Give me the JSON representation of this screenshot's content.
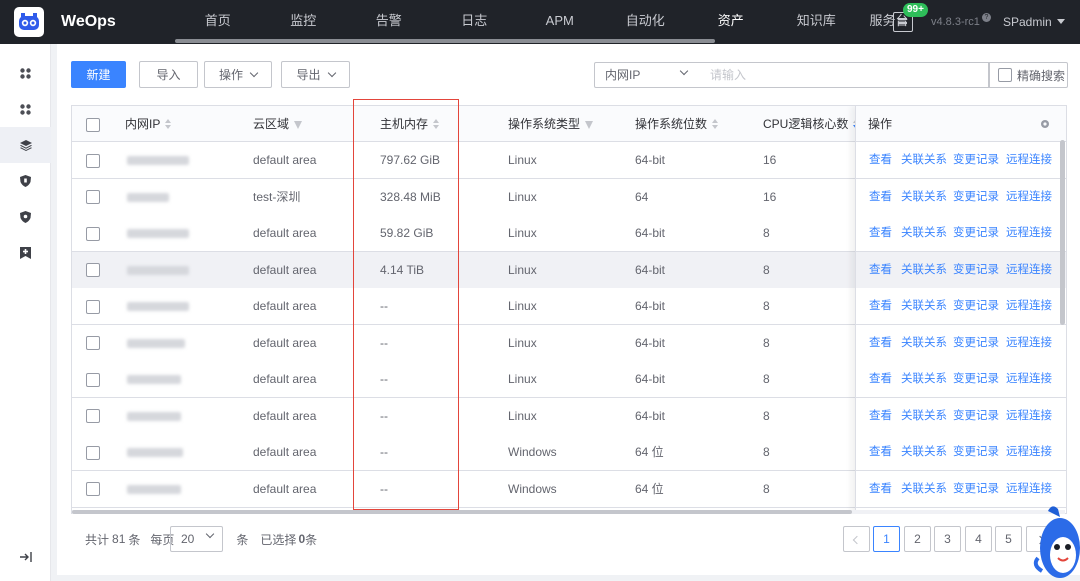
{
  "app": {
    "brand": "WeOps",
    "version": "v4.8.3-rc1",
    "user": "SPadmin",
    "notification_badge": "99+"
  },
  "nav": {
    "items": [
      {
        "label": "首页",
        "active": false
      },
      {
        "label": "监控",
        "active": false
      },
      {
        "label": "告警",
        "active": false
      },
      {
        "label": "日志",
        "active": false
      },
      {
        "label": "APM",
        "active": false
      },
      {
        "label": "自动化",
        "active": false
      },
      {
        "label": "资产",
        "active": true
      },
      {
        "label": "知识库",
        "active": false
      },
      {
        "label": "服务台",
        "active": false
      }
    ]
  },
  "sidebar": {
    "icons": [
      "grid-icon",
      "grid-icon",
      "layers-icon",
      "shield-icon",
      "shield-icon",
      "bookmark-add-icon",
      "collapse-icon"
    ],
    "active_index": 2
  },
  "toolbar": {
    "new_label": "新建",
    "import_label": "导入",
    "action_label": "操作",
    "export_label": "导出",
    "search_field": "内网IP",
    "search_placeholder": "请输入",
    "exact_label": "精确搜索"
  },
  "table": {
    "columns": [
      "内网IP",
      "云区域",
      "主机内存",
      "操作系统类型",
      "操作系统位数",
      "CPU逻辑核心数",
      "操作"
    ],
    "rows": [
      {
        "cloud": "default area",
        "memory": "797.62 GiB",
        "os": "Linux",
        "bits": "64-bit",
        "cpu": "16"
      },
      {
        "cloud": "test-深圳",
        "memory": "328.48 MiB",
        "os": "Linux",
        "bits": "64",
        "cpu": "16"
      },
      {
        "cloud": "default area",
        "memory": "59.82 GiB",
        "os": "Linux",
        "bits": "64-bit",
        "cpu": "8"
      },
      {
        "cloud": "default area",
        "memory": "4.14 TiB",
        "os": "Linux",
        "bits": "64-bit",
        "cpu": "8"
      },
      {
        "cloud": "default area",
        "memory": "--",
        "os": "Linux",
        "bits": "64-bit",
        "cpu": "8"
      },
      {
        "cloud": "default area",
        "memory": "--",
        "os": "Linux",
        "bits": "64-bit",
        "cpu": "8"
      },
      {
        "cloud": "default area",
        "memory": "--",
        "os": "Linux",
        "bits": "64-bit",
        "cpu": "8"
      },
      {
        "cloud": "default area",
        "memory": "--",
        "os": "Linux",
        "bits": "64-bit",
        "cpu": "8"
      },
      {
        "cloud": "default area",
        "memory": "--",
        "os": "Windows",
        "bits": "64 位",
        "cpu": "8"
      },
      {
        "cloud": "default area",
        "memory": "--",
        "os": "Windows",
        "bits": "64 位",
        "cpu": "8"
      }
    ],
    "actions": [
      "查看",
      "关联关系",
      "变更记录",
      "远程连接"
    ]
  },
  "footer": {
    "total_prefix": "共计",
    "total": "81",
    "total_suffix": "条",
    "per_page_label": "每页",
    "page_size": "20",
    "per_page_suffix": "条",
    "selected_prefix": "已选择",
    "selected": "0",
    "selected_suffix": "条",
    "pages": [
      "1",
      "2",
      "3",
      "4",
      "5"
    ],
    "current_page": "1"
  },
  "colors": {
    "accent": "#3a84ff",
    "topbar": "#202329",
    "highlight": "#e3453b",
    "badge": "#2ebd59"
  }
}
